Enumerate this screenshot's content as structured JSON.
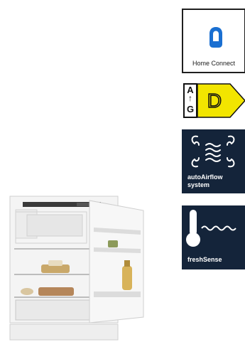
{
  "badges": {
    "home_connect": {
      "label": "Home Connect",
      "icon": "home-connect-icon",
      "color": "#1a6fd1"
    },
    "energy": {
      "scale_top": "A",
      "scale_arrow": "↑",
      "scale_bottom": "G",
      "class": "D",
      "color": "#f2e500"
    },
    "airflow": {
      "line1": "autoAirflow",
      "line2": "system",
      "icon": "airflow-icon",
      "bg": "#14243a"
    },
    "fresh_sense": {
      "label": "freshSense",
      "icon": "thermometer-wave-icon",
      "bg": "#14243a"
    }
  },
  "product": {
    "image": "built-in-fridge-open-door"
  }
}
